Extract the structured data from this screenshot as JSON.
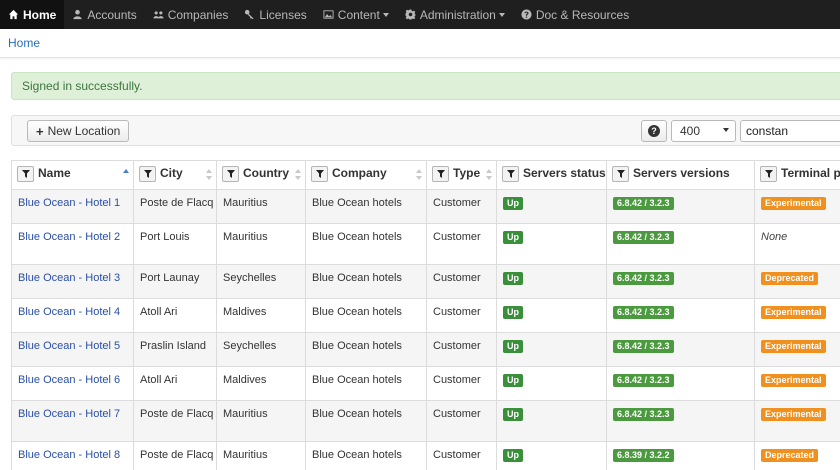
{
  "nav": {
    "home": "Home",
    "accounts": "Accounts",
    "companies": "Companies",
    "licenses": "Licenses",
    "content": "Content",
    "administration": "Administration",
    "docs": "Doc & Resources"
  },
  "breadcrumb": "Home",
  "alert": "Signed in successfully.",
  "toolbar": {
    "new_location": "New Location",
    "help_glyph": "?",
    "page_size": "400",
    "search_value": "constan"
  },
  "table": {
    "headers": [
      "Name",
      "City",
      "Country",
      "Company",
      "Type",
      "Servers status",
      "Servers versions",
      "Terminal packages"
    ],
    "rows": [
      {
        "name": "Blue Ocean - Hotel 1",
        "city": "Poste de Flacq",
        "country": "Mauritius",
        "company": "Blue Ocean hotels",
        "type": "Customer",
        "status": "Up",
        "version": "6.8.42 / 3.2.3",
        "terminal": "Experimental"
      },
      {
        "name": "Blue Ocean - Hotel 2",
        "city": "Port Louis",
        "country": "Mauritius",
        "company": "Blue Ocean hotels",
        "type": "Customer",
        "status": "Up",
        "version": "6.8.42 / 3.2.3",
        "terminal": "None"
      },
      {
        "name": "Blue Ocean - Hotel 3",
        "city": "Port Launay",
        "country": "Seychelles",
        "company": "Blue Ocean hotels",
        "type": "Customer",
        "status": "Up",
        "version": "6.8.42 / 3.2.3",
        "terminal": "Deprecated"
      },
      {
        "name": "Blue Ocean - Hotel 4",
        "city": "Atoll Ari",
        "country": "Maldives",
        "company": "Blue Ocean hotels",
        "type": "Customer",
        "status": "Up",
        "version": "6.8.42 / 3.2.3",
        "terminal": "Experimental"
      },
      {
        "name": "Blue Ocean - Hotel 5",
        "city": "Praslin Island",
        "country": "Seychelles",
        "company": "Blue Ocean hotels",
        "type": "Customer",
        "status": "Up",
        "version": "6.8.42 / 3.2.3",
        "terminal": "Experimental"
      },
      {
        "name": "Blue Ocean - Hotel 6",
        "city": "Atoll Ari",
        "country": "Maldives",
        "company": "Blue Ocean hotels",
        "type": "Customer",
        "status": "Up",
        "version": "6.8.42 / 3.2.3",
        "terminal": "Experimental"
      },
      {
        "name": "Blue Ocean - Hotel 7",
        "city": "Poste de Flacq",
        "country": "Mauritius",
        "company": "Blue Ocean hotels",
        "type": "Customer",
        "status": "Up",
        "version": "6.8.42 / 3.2.3",
        "terminal": "Experimental"
      },
      {
        "name": "Blue Ocean - Hotel 8",
        "city": "Poste de Flacq",
        "country": "Mauritius",
        "company": "Blue Ocean hotels",
        "type": "Customer",
        "status": "Up",
        "version": "6.8.39 / 3.2.2",
        "terminal": "Deprecated"
      }
    ]
  },
  "colors": {
    "navbar": "#1f1f1f",
    "link": "#2a4fa8",
    "badge_up": "#3a8f3a",
    "badge_warning": "#f0901e",
    "alert_bg": "#dff0d8"
  },
  "icons": {
    "home": "home-icon",
    "accounts": "user-icon",
    "companies": "users-icon",
    "licenses": "key-icon",
    "content": "image-icon",
    "administration": "gear-icon",
    "docs": "question-circle-icon",
    "filter": "filter-icon",
    "sort": "sort-icon"
  }
}
